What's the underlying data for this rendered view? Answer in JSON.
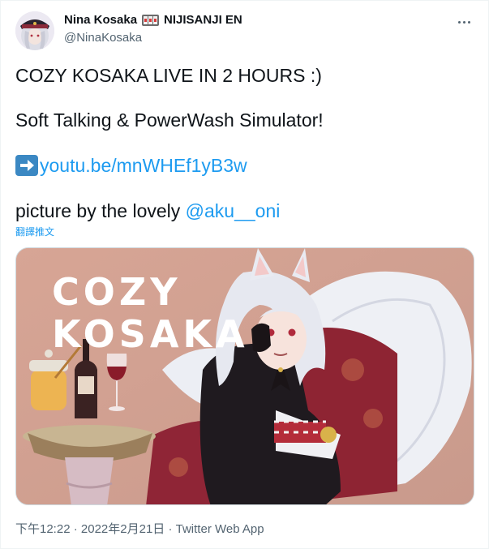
{
  "author": {
    "display_name": "Nina Kosaka",
    "affiliation": "NIJISANJI EN",
    "handle": "@NinaKosaka"
  },
  "tweet": {
    "line1": "COZY KOSAKA LIVE IN 2 HOURS :)",
    "line2": "Soft Talking & PowerWash Simulator!",
    "link_text": "youtu.be/mnWHEf1yB3w",
    "credit_prefix": "picture by the lovely ",
    "credit_mention": "@aku__oni",
    "translate_label": "翻譯推文"
  },
  "media": {
    "title_line1": "COZY",
    "title_line2": "KOSAKA"
  },
  "meta": {
    "time": "下午12:22",
    "separator": " · ",
    "date": "2022年2月21日",
    "source": "Twitter Web App"
  },
  "icons": {
    "more": "more-horizontal-icon",
    "arrow": "right-arrow-emoji",
    "badge": "slot-machine-emoji"
  },
  "colors": {
    "link": "#1d9bf0",
    "secondary_text": "#536471",
    "primary_text": "#0f1419"
  }
}
